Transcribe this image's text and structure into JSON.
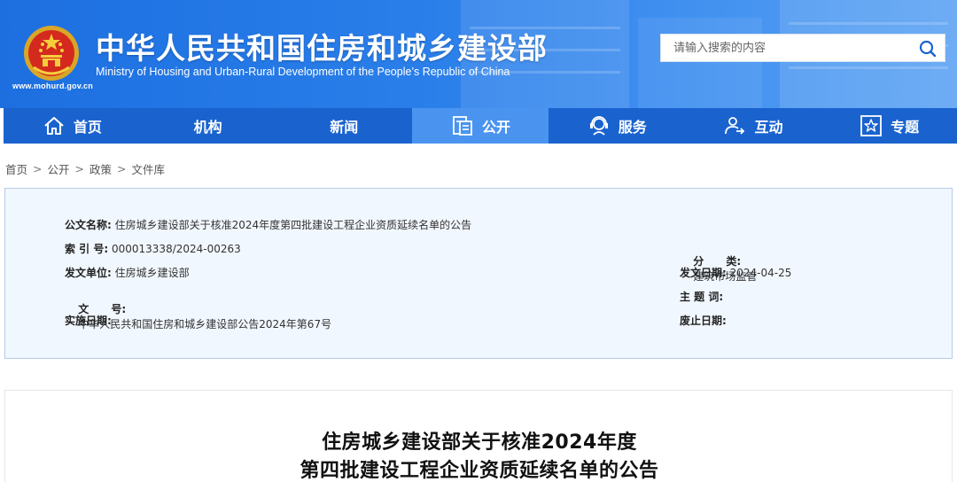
{
  "header": {
    "title": "中华人民共和国住房和城乡建设部",
    "subtitle": "Ministry of Housing and Urban-Rural Development of the People’s Republic of China",
    "url": "www.mohurd.gov.cn",
    "brand_color": "#1d6fe0",
    "emblem_icon": "national-emblem-icon"
  },
  "search": {
    "placeholder": "请输入搜索的内容",
    "icon": "search-icon"
  },
  "nav": {
    "items": [
      {
        "label": "首页",
        "icon": "home-icon",
        "active": false
      },
      {
        "label": "机构",
        "icon": "",
        "active": false
      },
      {
        "label": "新闻",
        "icon": "",
        "active": false
      },
      {
        "label": "公开",
        "icon": "document-icon",
        "active": true
      },
      {
        "label": "服务",
        "icon": "service-icon",
        "active": false
      },
      {
        "label": "互动",
        "icon": "interaction-icon",
        "active": false
      },
      {
        "label": "专题",
        "icon": "star-icon",
        "active": false
      }
    ],
    "active_color": "#4a94f0"
  },
  "breadcrumb": {
    "items": [
      "首页",
      "公开",
      "政策",
      "文件库"
    ],
    "separator": ">"
  },
  "doc_info": {
    "name_label": "公文名称:",
    "name_value": "住房城乡建设部关于核准2024年度第四批建设工程企业资质延续名单的公告",
    "index_label": "索 引 号:",
    "index_value": "000013338/2024-00263",
    "category_label": "分      类:",
    "category_value": "建筑市场监管",
    "issuer_label": "发文单位:",
    "issuer_value": "住房城乡建设部",
    "date_label": "发文日期:",
    "date_value": "2024-04-25",
    "docno_label": "文      号:",
    "docno_value": "中华人民共和国住房和城乡建设部公告2024年第67号",
    "subject_label": "主 题 词:",
    "subject_value": "",
    "effective_label": "实施日期:",
    "effective_value": "",
    "expiry_label": "废止日期:",
    "expiry_value": ""
  },
  "article": {
    "title_line1": "住房城乡建设部关于核准2024年度",
    "title_line2": "第四批建设工程企业资质延续名单的公告"
  }
}
